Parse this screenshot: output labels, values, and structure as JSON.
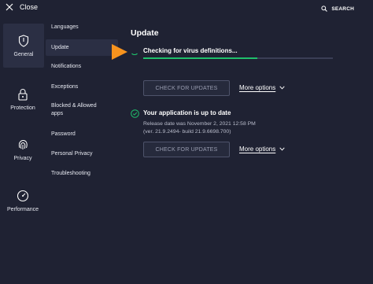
{
  "topbar": {
    "close_label": "Close",
    "search_label": "SEARCH"
  },
  "rail": {
    "items": [
      {
        "label": "General",
        "icon": "shield-icon",
        "active": true
      },
      {
        "label": "Protection",
        "icon": "lock-icon",
        "active": false
      },
      {
        "label": "Privacy",
        "icon": "fingerprint-icon",
        "active": false
      },
      {
        "label": "Performance",
        "icon": "speedometer-icon",
        "active": false
      }
    ]
  },
  "submenu": {
    "items": [
      {
        "label": "Languages"
      },
      {
        "label": "Update",
        "active": true
      },
      {
        "label": "Notifications"
      },
      {
        "label": "Exceptions"
      },
      {
        "label": "Blocked & Allowed apps"
      },
      {
        "label": "Password"
      },
      {
        "label": "Personal Privacy"
      },
      {
        "label": "Troubleshooting"
      }
    ]
  },
  "main": {
    "title": "Update",
    "definitions": {
      "status_text": "Checking for virus definitions...",
      "progress": 0.6,
      "button_label": "CHECK FOR UPDATES",
      "more_label": "More options"
    },
    "application": {
      "status_title": "Your application is up to date",
      "release_line1": "Release date was November 2, 2021 12:58 PM",
      "release_line2": "(ver. 21.9.2494- build 21.9.6698.700)",
      "button_label": "CHECK FOR UPDATES",
      "more_label": "More options"
    }
  },
  "colors": {
    "background": "#1f2233",
    "active": "#2b2f44",
    "accent_orange": "#f7931e",
    "success_green": "#1fbf6b"
  }
}
